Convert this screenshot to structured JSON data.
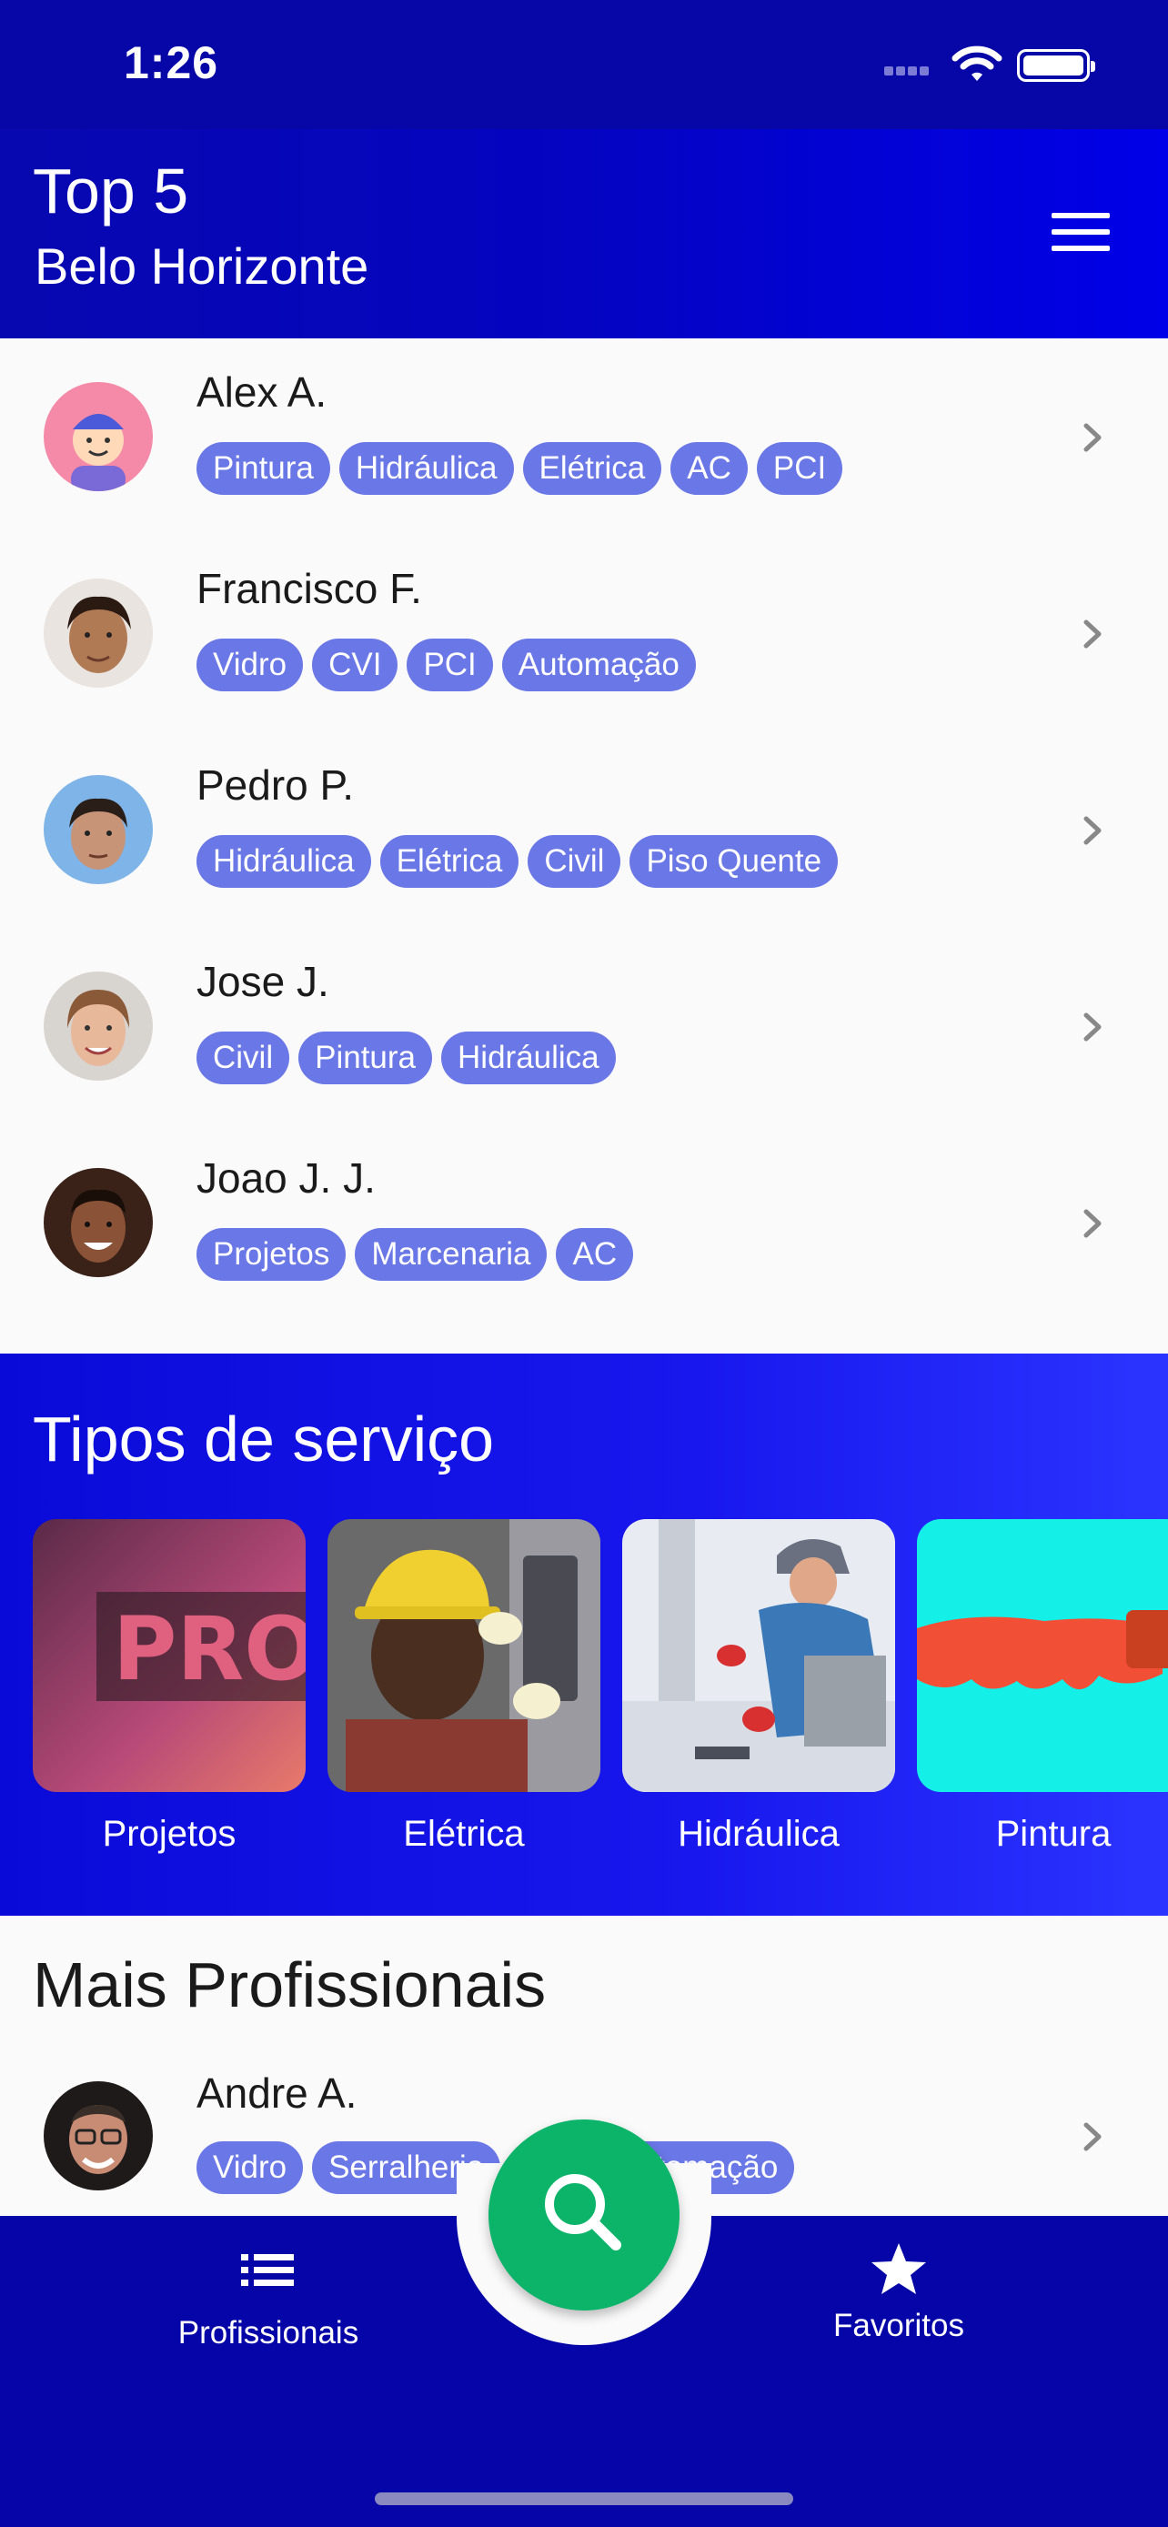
{
  "status_bar": {
    "time": "1:26"
  },
  "header": {
    "title": "Top 5",
    "subtitle": "Belo Horizonte"
  },
  "top5": [
    {
      "name": "Alex A.",
      "tags": [
        "Pintura",
        "Hidráulica",
        "Elétrica",
        "AC",
        "PCI"
      ]
    },
    {
      "name": "Francisco F.",
      "tags": [
        "Vidro",
        "CVI",
        "PCI",
        "Automação"
      ]
    },
    {
      "name": "Pedro P.",
      "tags": [
        "Hidráulica",
        "Elétrica",
        "Civil",
        "Piso Quente"
      ]
    },
    {
      "name": "Jose J.",
      "tags": [
        "Civil",
        "Pintura",
        "Hidráulica"
      ]
    },
    {
      "name": "Joao J. J.",
      "tags": [
        "Projetos",
        "Marcenaria",
        "AC"
      ]
    }
  ],
  "services": {
    "title": "Tipos de serviço",
    "items": [
      {
        "label": "Projetos"
      },
      {
        "label": "Elétrica"
      },
      {
        "label": "Hidráulica"
      },
      {
        "label": "Pintura"
      }
    ]
  },
  "more": {
    "title": "Mais Profissionais",
    "items": [
      {
        "name": "Andre A.",
        "tags": [
          "Vidro",
          "Serralheria",
          "",
          "Automação"
        ]
      }
    ]
  },
  "tabbar": {
    "left_label": "Profissionais",
    "right_label": "Favoritos",
    "left_icon": "list-icon",
    "right_icon": "star-icon",
    "center_icon": "search-icon"
  },
  "colors": {
    "primary": "#0505a8",
    "tag": "#6a77e6",
    "fab": "#0cb46a",
    "services_bg": "#1414e6"
  }
}
